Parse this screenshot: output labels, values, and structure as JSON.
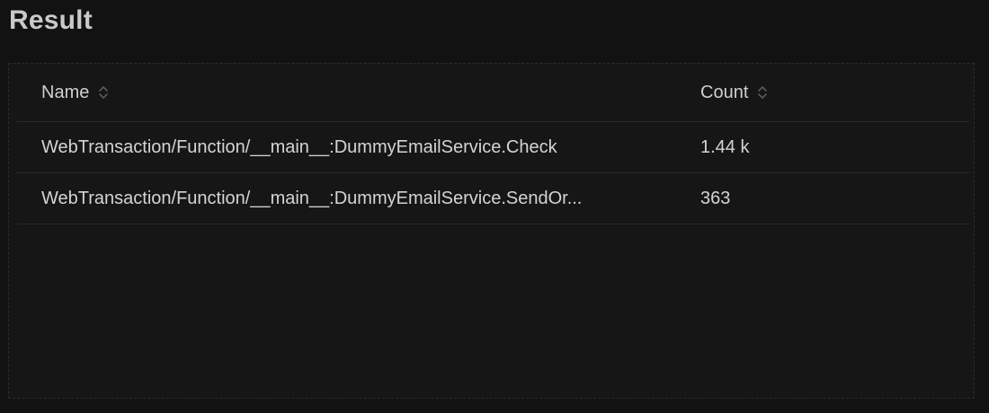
{
  "page": {
    "title": "Result"
  },
  "table": {
    "columns": [
      {
        "label": "Name",
        "icon": "sort-icon"
      },
      {
        "label": "Count",
        "icon": "sort-icon"
      }
    ],
    "rows": [
      {
        "name": "WebTransaction/Function/__main__:DummyEmailService.Check",
        "count": "1.44 k"
      },
      {
        "name": "WebTransaction/Function/__main__:DummyEmailService.SendOr...",
        "count": "363"
      }
    ]
  },
  "colors": {
    "background": "#121212",
    "panel": "#161616",
    "text": "#d4d4d4",
    "divider": "#2a2a2a"
  }
}
